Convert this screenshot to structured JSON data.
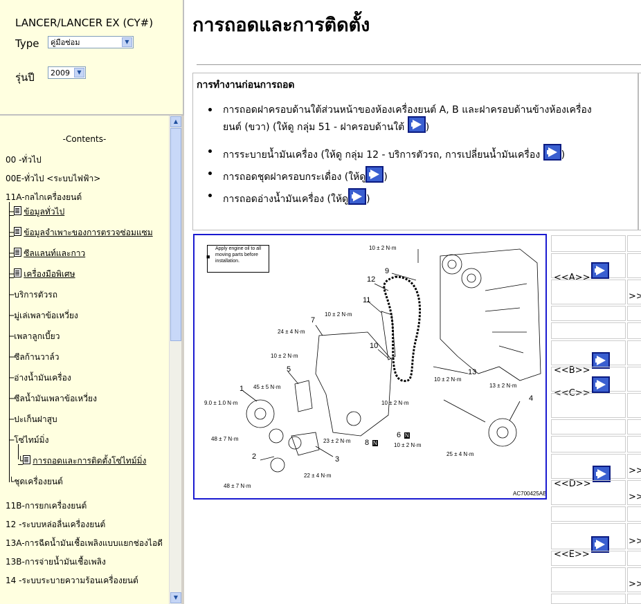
{
  "left_top": {
    "model": "LANCER/LANCER EX (CY#)",
    "type_label": "Type",
    "type_value": "คู่มือซ่อม",
    "year_label": "รุ่นปี",
    "year_value": "2009"
  },
  "tree": {
    "heading": "-Contents-",
    "items": [
      "00 -ทั่วไป",
      "00E-ทั่วไป <ระบบไฟฟ้า>",
      "11A-กลไกเครื่องยนต์",
      "ข้อมูลทั่วไป",
      "ข้อมูลจำเพาะของการตรวจซ่อมแซม",
      "ซีลแลนท์และกาว",
      "เครื่องมือพิเศษ",
      "บริการตัวรถ",
      "มู่เล่เพลาข้อเหวี่ยง",
      "เพลาลูกเบี้ยว",
      "ซีลก้านวาล์ว",
      "อ่างน้ำมันเครื่อง",
      "ซีลน้ำมันเพลาข้อเหวี่ยง",
      "ปะเก็นฝาสูบ",
      "โซ่ไทม์มิ่ง",
      "การถอดและการติดตั้งโซ่ไทม์มิ่ง",
      "ชุดเครื่องยนต์",
      "11B-การยกเครื่องยนต์",
      "12 -ระบบหล่อลื่นเครื่องยนต์",
      "13A-การฉีดน้ำมันเชื้อเพลิงแบบแยกช่องไอดี",
      "13B-การจ่ายน้ำมันเชื้อเพลิง",
      "14 -ระบบระบายความร้อนเครื่องยนต์"
    ]
  },
  "main": {
    "title": "การถอดและการติดตั้ง",
    "pre_heading": "การทำงานก่อนการถอด",
    "bullets": {
      "b1_line1": "การถอดฝาครอบด้านใต้ส่วนหน้าของห้องเครื่องยนต์ A, B และฝาครอบด้านข้างห้องเครื่อง",
      "b1_line2": "ยนต์ (ขวา) (ให้ดู กลุ่ม 51 - ฝาครอบด้านใต้",
      "b2": "การระบายน้ำมันเครื่อง (ให้ดู กลุ่ม 12 - บริการตัวรถ, การเปลี่ยนน้ำมันเครื่อง",
      "b3": "การถอดชุดฝาครอบกระเดื่อง (ให้ดู",
      "b4": "การถอดอ่างน้ำมันเครื่อง (ให้ดู",
      "close": ")"
    }
  },
  "diagram": {
    "note": "Apply engine oil to all moving parts before installation.",
    "code": "AC700425AB",
    "torques": [
      "10 ± 2 N·m",
      "10 ± 2 N·m",
      "24 ± 4 N·m",
      "10 ± 2 N·m",
      "45 ± 5 N·m",
      "9.0 ± 1.0 N·m",
      "48 ± 7 N·m",
      "23 ± 2 N·m",
      "22 ± 4 N·m",
      "48 ± 7 N·m",
      "10 ± 2 N·m",
      "10 ± 2 N·m",
      "10 ± 2 N·m",
      "13 ± 2 N·m",
      "25 ± 4 N·m",
      "10 ± 2 N·m"
    ],
    "numbers": [
      "9",
      "12",
      "11",
      "7",
      "10",
      "5",
      "1",
      "2",
      "3",
      "8",
      "6",
      "13",
      "4"
    ],
    "n_mark": "N"
  },
  "side_table": {
    "labels": [
      "<<A>>",
      "<<B>>",
      "<<C>>",
      "<<D>>",
      "<<E>>"
    ],
    "more": ">>"
  }
}
